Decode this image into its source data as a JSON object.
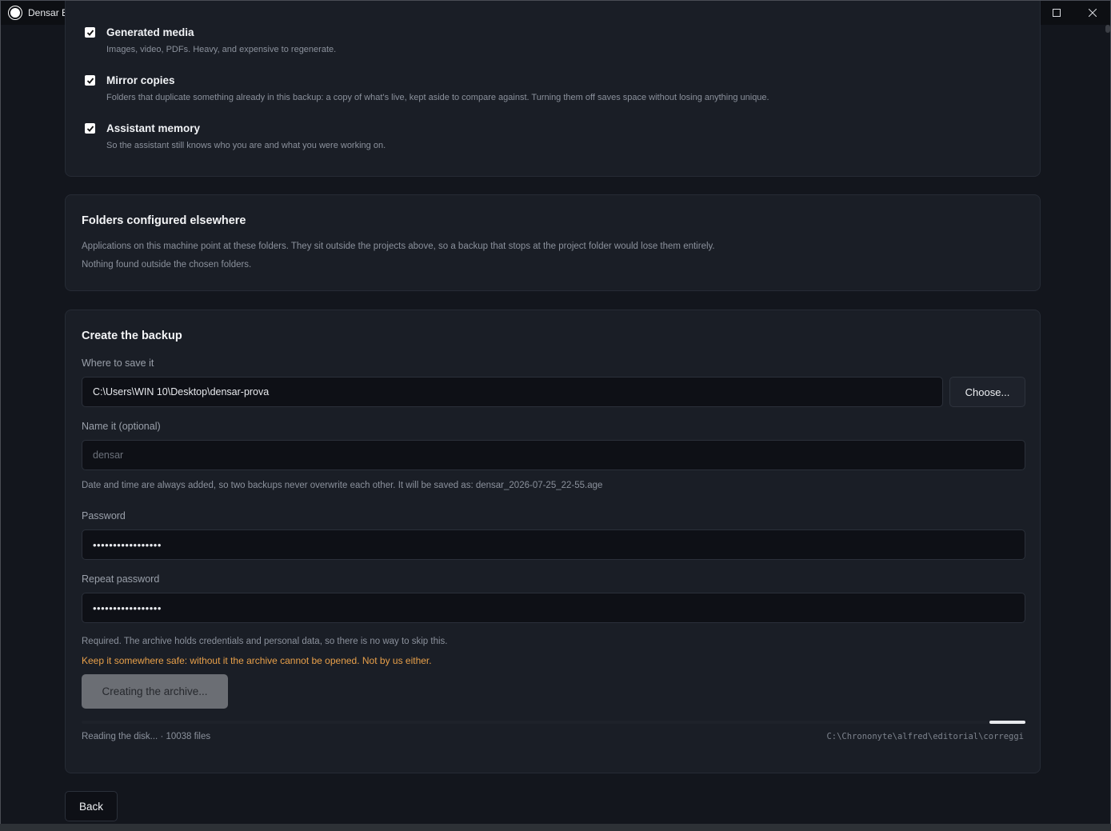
{
  "window": {
    "title": "Densar BK",
    "minimize_label": "—",
    "maximize_label": "☐",
    "close_label": "✕"
  },
  "options": [
    {
      "title": "Generated media",
      "description": "Images, video, PDFs. Heavy, and expensive to regenerate.",
      "checked": true
    },
    {
      "title": "Mirror copies",
      "description": "Folders that duplicate something already in this backup: a copy of what's live, kept aside to compare against. Turning them off saves space without losing anything unique.",
      "checked": true
    },
    {
      "title": "Assistant memory",
      "description": "So the assistant still knows who you are and what you were working on.",
      "checked": true
    }
  ],
  "elsewhere": {
    "heading": "Folders configured elsewhere",
    "description": "Applications on this machine point at these folders. They sit outside the projects above, so a backup that stops at the project folder would lose them entirely.",
    "empty_message": "Nothing found outside the chosen folders."
  },
  "create": {
    "heading": "Create the backup",
    "save_location_label": "Where to save it",
    "save_location_value": "C:\\Users\\WIN 10\\Desktop\\densar-prova",
    "choose_button": "Choose...",
    "name_label": "Name it (optional)",
    "name_placeholder": "densar",
    "name_hint": "Date and time are always added, so two backups never overwrite each other. It will be saved as: densar_2026-07-25_22-55.age",
    "password_label": "Password",
    "password_value": "•••••••••••••••••",
    "repeat_password_label": "Repeat password",
    "repeat_password_value": "•••••••••••••••••",
    "required_note": "Required. The archive holds credentials and personal data, so there is no way to skip this.",
    "warning": "Keep it somewhere safe: without it the archive cannot be opened. Not by us either.",
    "creating_button": "Creating the archive...",
    "progress_status": "Reading the disk... · 10038 files",
    "progress_path": "C:\\Chrononyte\\alfred\\editorial\\correggi",
    "progress_fraction": 0.04,
    "progress_offset": 0.962
  },
  "back_button": "Back",
  "colors": {
    "background": "#13161d",
    "card": "#1a1e26",
    "warning": "#e8a04a",
    "button_disabled": "#6b6e74"
  }
}
